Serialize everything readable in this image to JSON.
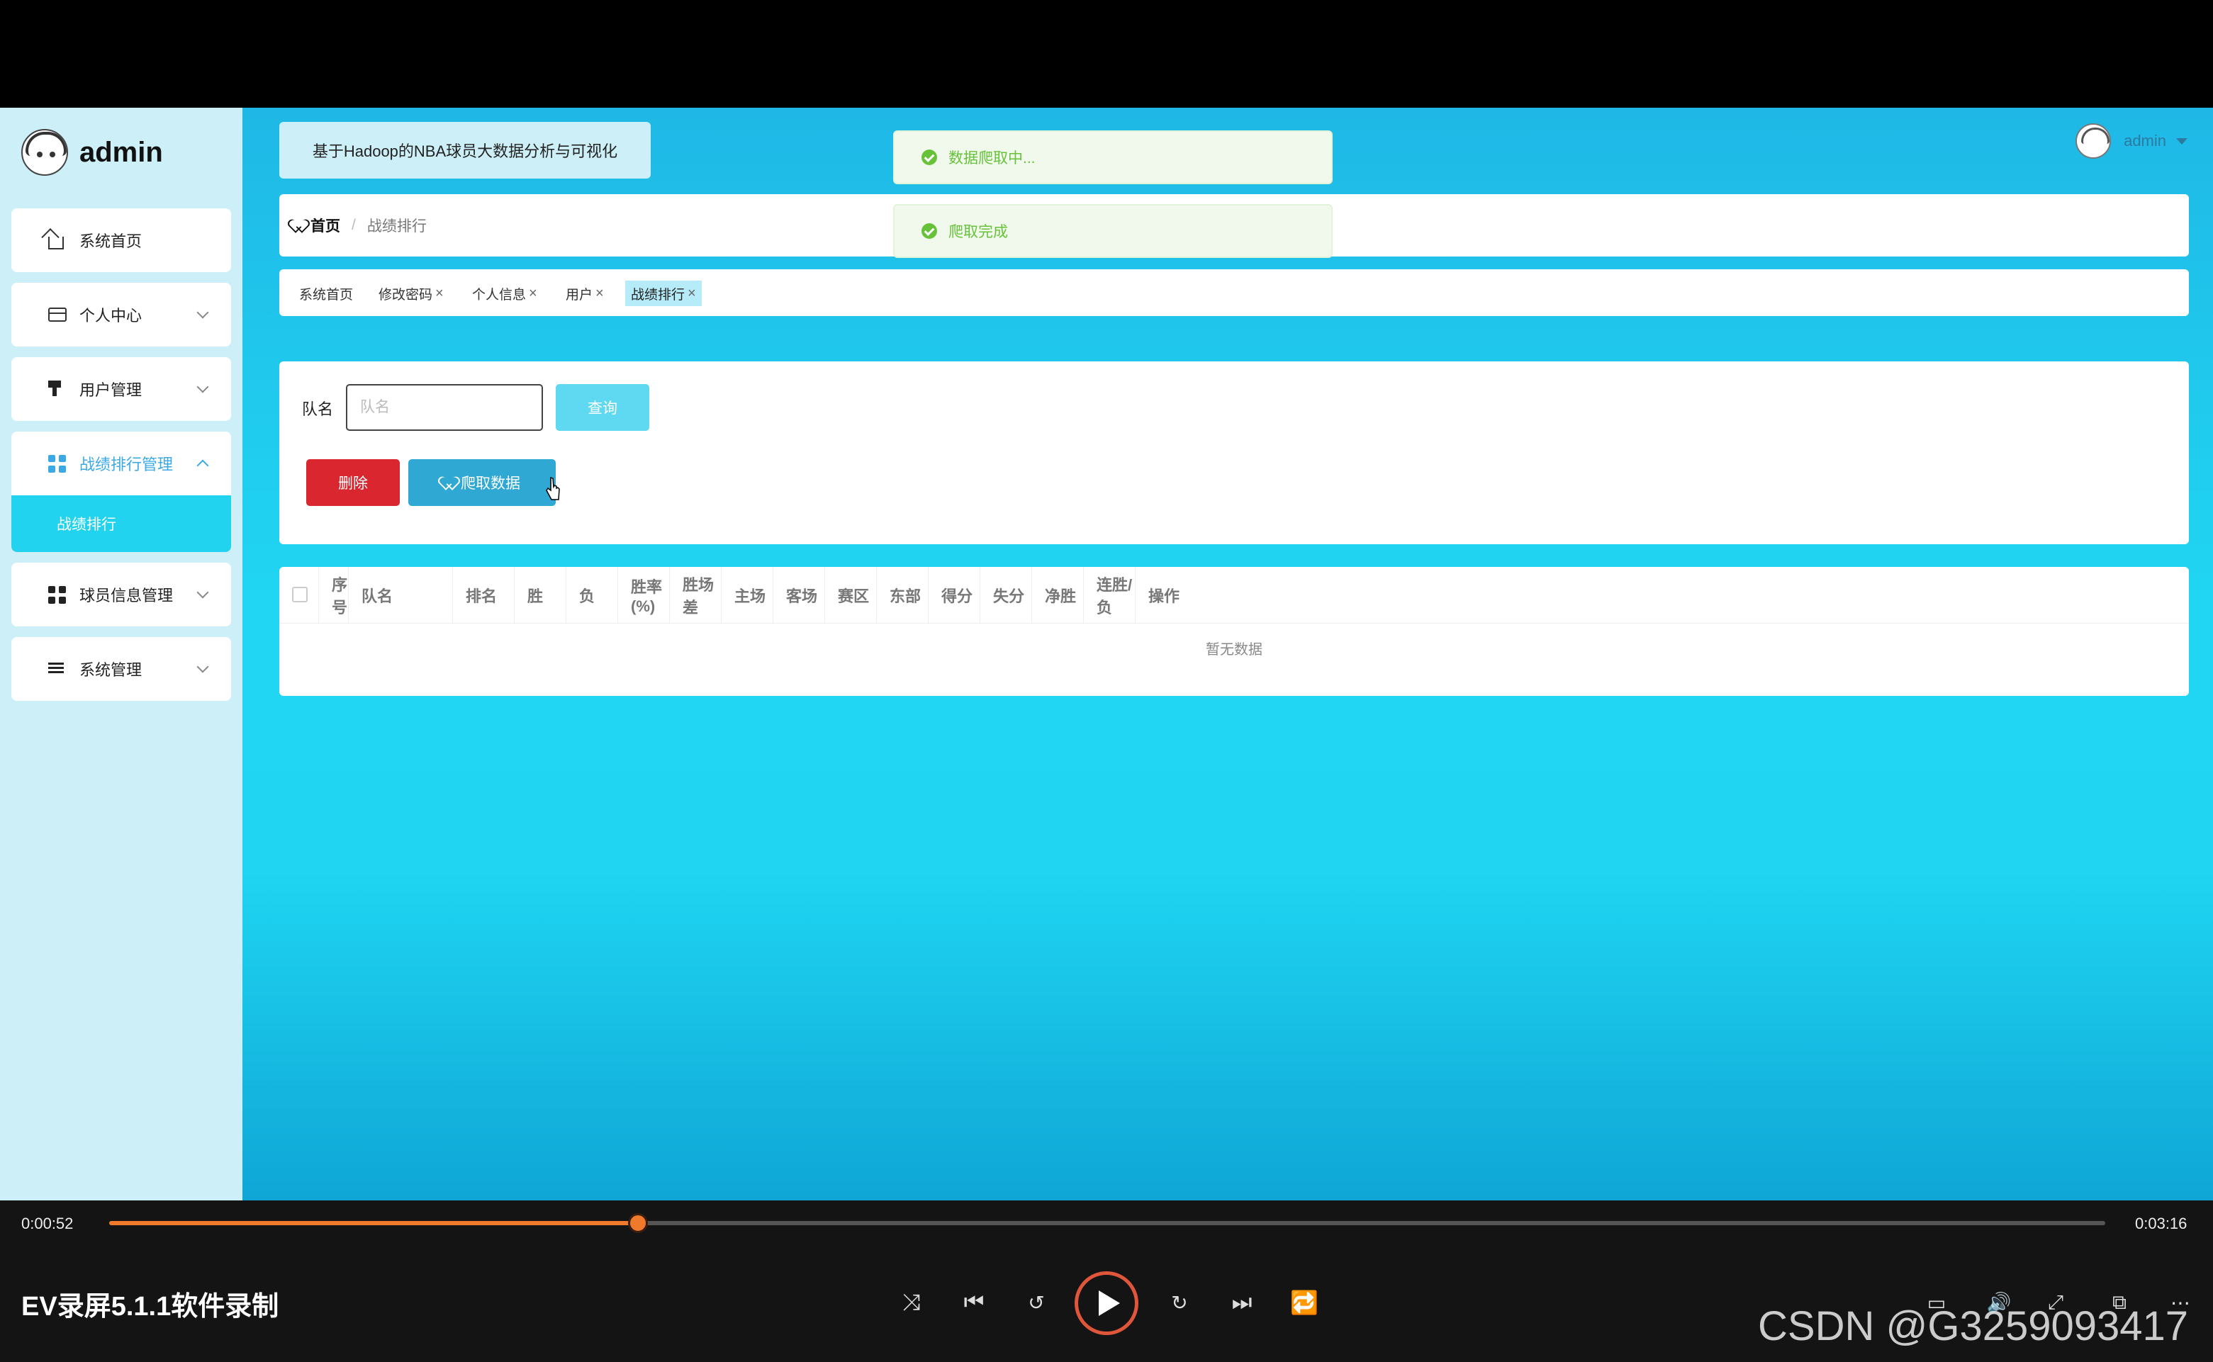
{
  "brand": {
    "name": "admin"
  },
  "sidebar": {
    "items": [
      {
        "label": "系统首页",
        "icon": "home-icon"
      },
      {
        "label": "个人中心",
        "icon": "card-icon"
      },
      {
        "label": "用户管理",
        "icon": "user-icon"
      },
      {
        "label": "战绩排行管理",
        "icon": "grid-icon",
        "children": [
          {
            "label": "战绩排行"
          }
        ]
      },
      {
        "label": "球员信息管理",
        "icon": "grid-icon"
      },
      {
        "label": "系统管理",
        "icon": "list-icon"
      }
    ]
  },
  "header": {
    "system_title": "基于Hadoop的NBA球员大数据分析与可视化",
    "user_name": "admin"
  },
  "breadcrumb": {
    "home": "首页",
    "separator": "/",
    "current": "战绩排行"
  },
  "tabs": [
    {
      "label": "系统首页",
      "closable": false
    },
    {
      "label": "修改密码",
      "closable": true
    },
    {
      "label": "个人信息",
      "closable": true
    },
    {
      "label": "用户",
      "closable": true
    },
    {
      "label": "战绩排行",
      "closable": true,
      "active": true
    }
  ],
  "search": {
    "label": "队名",
    "placeholder": "队名",
    "value": "",
    "query_button": "查询",
    "delete_button": "删除",
    "crawl_button": "爬取数据"
  },
  "table": {
    "columns": [
      "序号",
      "队名",
      "排名",
      "胜",
      "负",
      "胜率(%)",
      "胜场差",
      "主场",
      "客场",
      "赛区",
      "东部",
      "得分",
      "失分",
      "净胜",
      "连胜/负",
      "操作"
    ],
    "empty_text": "暂无数据"
  },
  "toasts": [
    {
      "text": "数据爬取中..."
    },
    {
      "text": "爬取完成"
    }
  ],
  "player": {
    "current_time": "0:00:52",
    "total_time": "0:03:16",
    "progress": 0.265,
    "title": "EV录屏5.1.1软件录制",
    "accent_color": "#f07a2c"
  },
  "watermark": "CSDN @G3259093417"
}
